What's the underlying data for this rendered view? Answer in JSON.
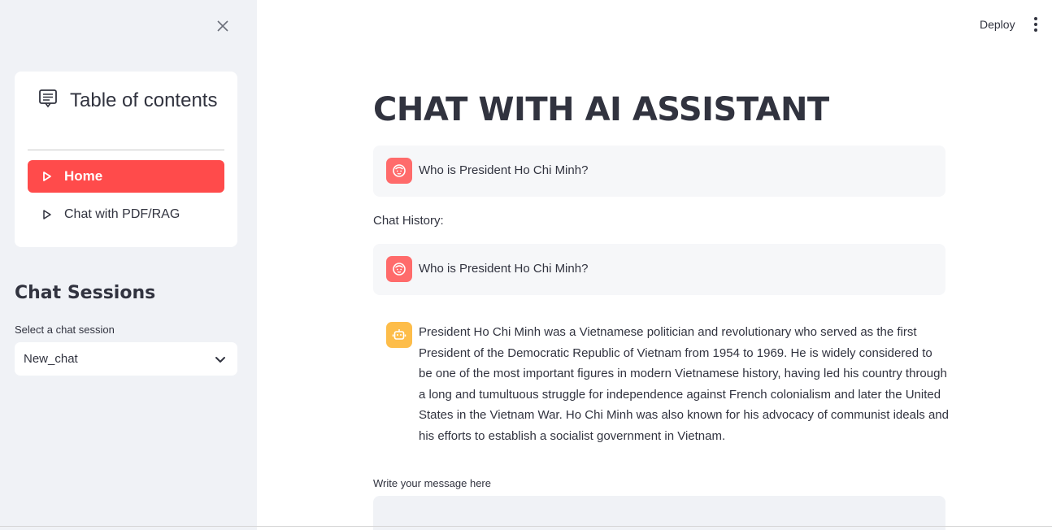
{
  "sidebar": {
    "toc_title": "Table of contents",
    "nav_items": [
      {
        "label": "Home",
        "active": true
      },
      {
        "label": "Chat with PDF/RAG",
        "active": false
      }
    ],
    "sessions_title": "Chat Sessions",
    "select_label": "Select a chat session",
    "select_value": "New_chat"
  },
  "header": {
    "deploy_label": "Deploy"
  },
  "main": {
    "title": "CHAT WITH AI ASSISTANT",
    "current_user_message": "Who is President Ho Chi Minh?",
    "history_label": "Chat History:",
    "history": [
      {
        "role": "user",
        "text": "Who is President Ho Chi Minh?"
      },
      {
        "role": "assistant",
        "text": "President Ho Chi Minh was a Vietnamese politician and revolutionary who served as the first President of the Democratic Republic of Vietnam from 1954 to 1969. He is widely considered to be one of the most important figures in modern Vietnamese history, having led his country through a long and tumultuous struggle for independence against French colonialism and later the United States in the Vietnam War. Ho Chi Minh was also known for his advocacy of communist ideals and his efforts to establish a socialist government in Vietnam."
      }
    ],
    "input_label": "Write your message here",
    "input_value": ""
  },
  "colors": {
    "accent": "#ff4b4b",
    "sidebar_bg": "#f0f2f6",
    "user_avatar": "#ff6b6b",
    "bot_avatar": "#fdbd4a"
  }
}
